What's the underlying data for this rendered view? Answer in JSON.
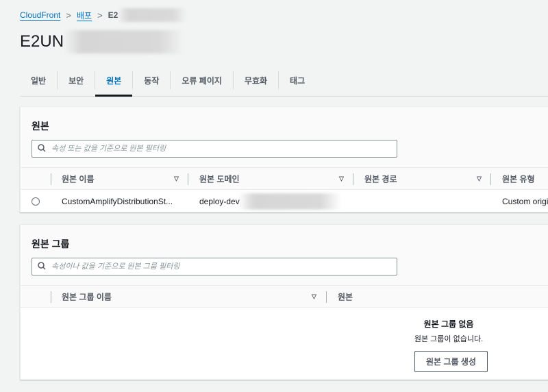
{
  "breadcrumb": {
    "items": [
      "CloudFront",
      "배포"
    ],
    "current": "E2"
  },
  "page_title": "E2UN",
  "tabs": [
    "일반",
    "보안",
    "원본",
    "동작",
    "오류 페이지",
    "무효화",
    "태그"
  ],
  "origins": {
    "title": "원본",
    "search_placeholder": "속성 또는 값을 기준으로 원본 필터링",
    "columns": [
      "원본 이름",
      "원본 도메인",
      "원본 경로",
      "원본 유형"
    ],
    "rows": [
      {
        "name": "CustomAmplifyDistributionSt...",
        "domain": "deploy-dev",
        "path": "",
        "type": "Custom origi"
      }
    ]
  },
  "origin_groups": {
    "title": "원본 그룹",
    "search_placeholder": "속성이나 값을 기준으로 원본 그룹 필터링",
    "columns": [
      "원본 그룹 이름",
      "원본"
    ],
    "empty_title": "원본 그룹 없음",
    "empty_text": "원본 그룹이 없습니다.",
    "create_button": "원본 그룹 생성"
  }
}
